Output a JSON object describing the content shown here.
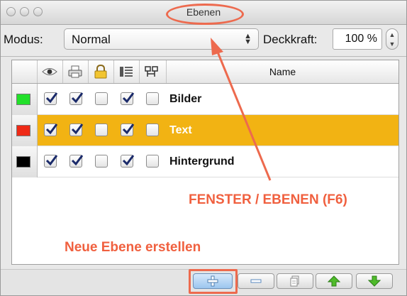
{
  "window": {
    "title": "Ebenen"
  },
  "toolbar": {
    "mode_label": "Modus:",
    "mode_value": "Normal",
    "opacity_label": "Deckkraft:",
    "opacity_value": "100 %"
  },
  "table": {
    "columns": [
      {
        "icon": "eye-icon"
      },
      {
        "icon": "print-icon"
      },
      {
        "icon": "lock-icon"
      },
      {
        "icon": "text-flow-icon"
      },
      {
        "icon": "layer-link-icon"
      }
    ],
    "name_header": "Name",
    "rows": [
      {
        "name": "Bilder",
        "color": "#22e02a",
        "selected": false,
        "visible": true,
        "print": true,
        "locked": false,
        "flow": true,
        "link": false
      },
      {
        "name": "Text",
        "color": "#ee2a16",
        "selected": true,
        "visible": true,
        "print": true,
        "locked": false,
        "flow": true,
        "link": false
      },
      {
        "name": "Hintergrund",
        "color": "#000000",
        "selected": false,
        "visible": true,
        "print": true,
        "locked": false,
        "flow": true,
        "link": false
      }
    ]
  },
  "annotations": {
    "menu_path": "FENSTER / EBENEN (F6)",
    "new_layer_hint": "Neue Ebene erstellen",
    "color": "#ed6a4e"
  },
  "buttons": [
    {
      "icon": "plus-icon"
    },
    {
      "icon": "minus-icon"
    },
    {
      "icon": "duplicate-icon"
    },
    {
      "icon": "arrow-up-icon"
    },
    {
      "icon": "arrow-down-icon"
    }
  ],
  "colors": {
    "selection": "#f2b313",
    "accent_red": "#ed6a4e"
  }
}
